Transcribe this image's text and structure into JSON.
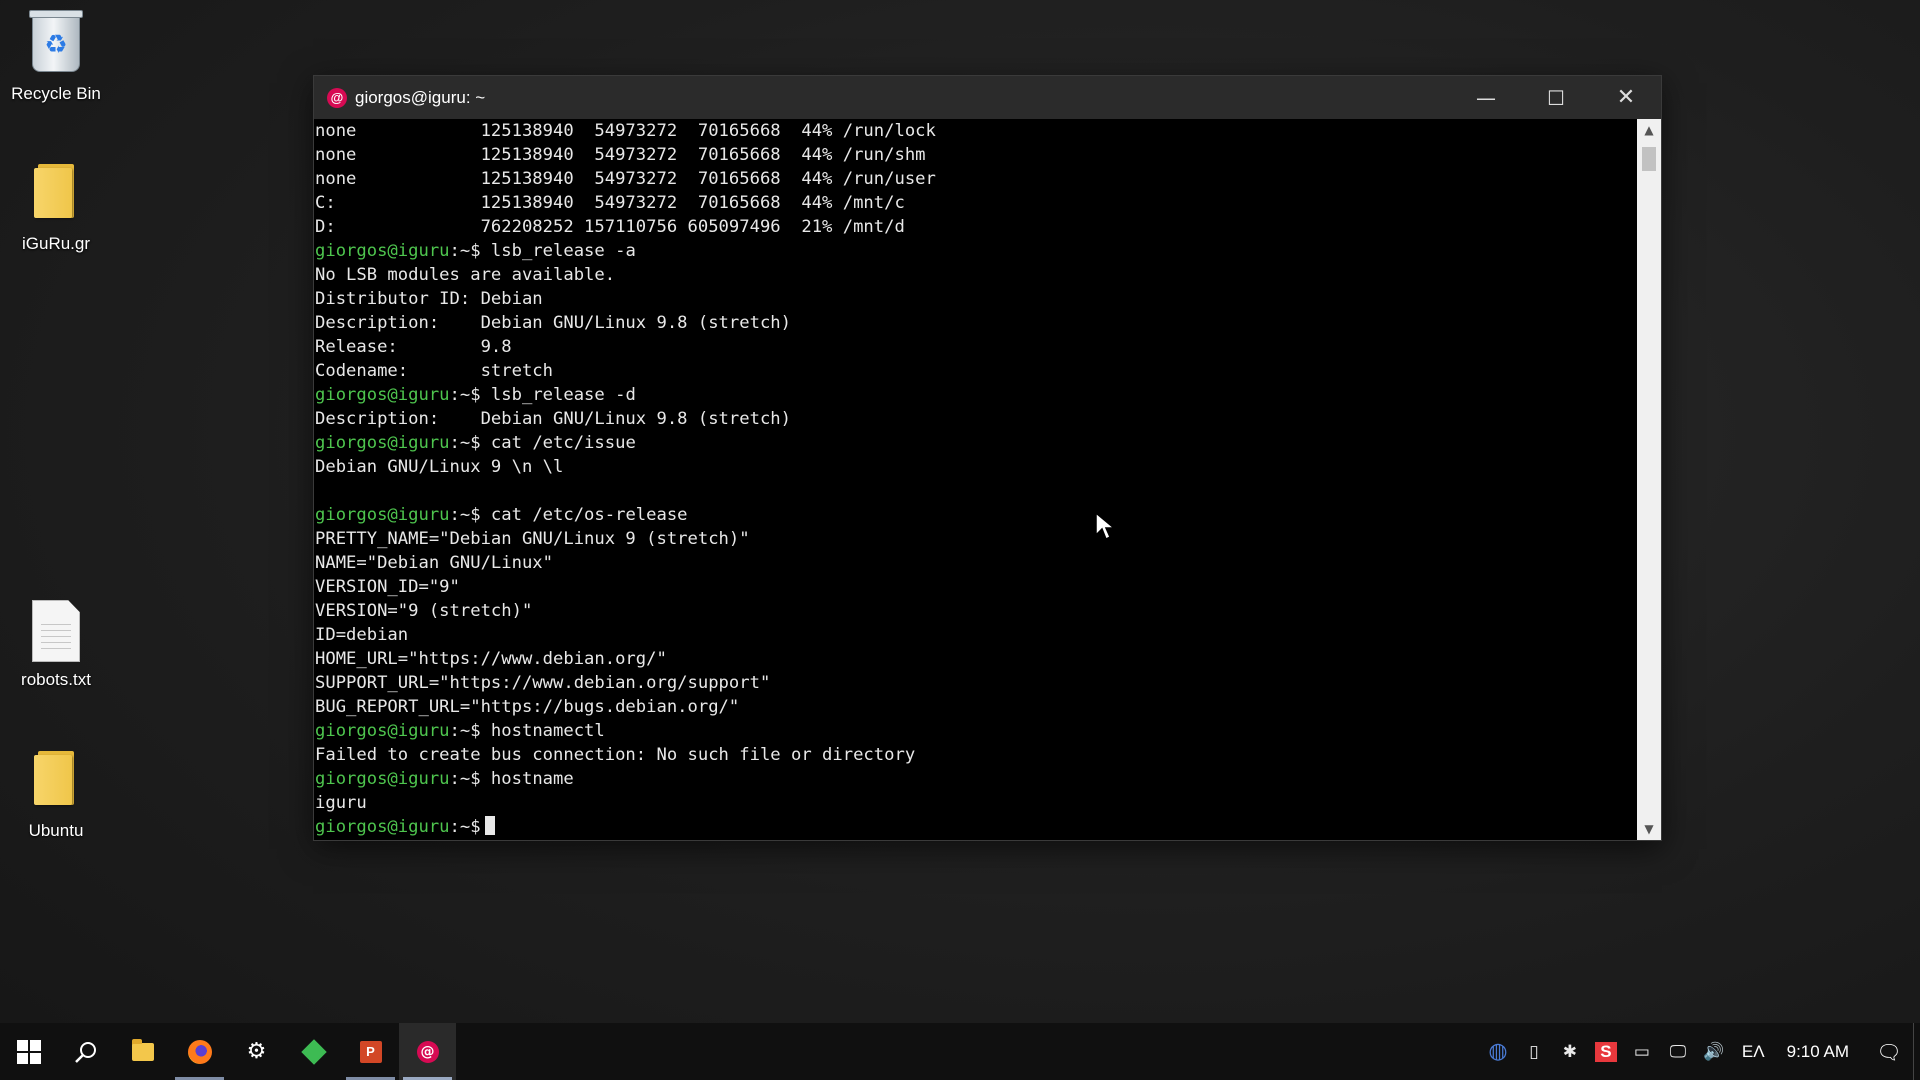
{
  "desktop": {
    "icons": [
      {
        "label": "Recycle Bin",
        "icon": "recycle-bin-icon"
      },
      {
        "label": "iGuRu.gr",
        "icon": "folder-icon"
      },
      {
        "label": "robots.txt",
        "icon": "text-file-icon"
      },
      {
        "label": "Ubuntu",
        "icon": "folder-icon"
      }
    ]
  },
  "window": {
    "title": "giorgos@iguru: ~",
    "app_icon": "debian-swirl-icon",
    "minimize_glyph": "—",
    "maximize_glyph": "☐",
    "close_glyph": "✕"
  },
  "terminal": {
    "prompt": "giorgos@iguru",
    "prompt_suffix": ":~$",
    "lines": [
      {
        "text": "none            125138940  54973272  70165668  44% /run/lock"
      },
      {
        "text": "none            125138940  54973272  70165668  44% /run/shm"
      },
      {
        "text": "none            125138940  54973272  70165668  44% /run/user"
      },
      {
        "text": "C:              125138940  54973272  70165668  44% /mnt/c"
      },
      {
        "text": "D:              762208252 157110756 605097496  21% /mnt/d"
      },
      {
        "prompt": true,
        "text": " lsb_release -a"
      },
      {
        "text": "No LSB modules are available."
      },
      {
        "text": "Distributor ID: Debian"
      },
      {
        "text": "Description:    Debian GNU/Linux 9.8 (stretch)"
      },
      {
        "text": "Release:        9.8"
      },
      {
        "text": "Codename:       stretch"
      },
      {
        "prompt": true,
        "text": " lsb_release -d"
      },
      {
        "text": "Description:    Debian GNU/Linux 9.8 (stretch)"
      },
      {
        "prompt": true,
        "text": " cat /etc/issue"
      },
      {
        "text": "Debian GNU/Linux 9 \\n \\l"
      },
      {
        "text": ""
      },
      {
        "prompt": true,
        "text": " cat /etc/os-release"
      },
      {
        "text": "PRETTY_NAME=\"Debian GNU/Linux 9 (stretch)\""
      },
      {
        "text": "NAME=\"Debian GNU/Linux\""
      },
      {
        "text": "VERSION_ID=\"9\""
      },
      {
        "text": "VERSION=\"9 (stretch)\""
      },
      {
        "text": "ID=debian"
      },
      {
        "text": "HOME_URL=\"https://www.debian.org/\""
      },
      {
        "text": "SUPPORT_URL=\"https://www.debian.org/support\""
      },
      {
        "text": "BUG_REPORT_URL=\"https://bugs.debian.org/\""
      },
      {
        "prompt": true,
        "text": " hostnamectl"
      },
      {
        "text": "Failed to create bus connection: No such file or directory"
      },
      {
        "prompt": true,
        "text": " hostname"
      },
      {
        "text": "iguru"
      },
      {
        "prompt": true,
        "text": "",
        "cursor": true
      }
    ]
  },
  "colors": {
    "prompt": "#4ec54e",
    "terminal_bg": "#000000",
    "terminal_fg": "#e8e8e8",
    "titlebar_bg": "#2b2b2b",
    "taskbar_bg": "#101010"
  },
  "taskbar": {
    "items": [
      {
        "name": "start-button",
        "icon": "windows-logo-icon"
      },
      {
        "name": "search-button",
        "icon": "search-icon",
        "glyph": "⚲"
      },
      {
        "name": "file-explorer-button",
        "icon": "folder-icon"
      },
      {
        "name": "firefox-button",
        "icon": "firefox-icon",
        "state": "running"
      },
      {
        "name": "settings-button",
        "icon": "gear-icon",
        "glyph": "⚙"
      },
      {
        "name": "green-app-button",
        "icon": "green-diamond-icon"
      },
      {
        "name": "powerpoint-button",
        "icon": "powerpoint-icon",
        "glyph": "P",
        "state": "running"
      },
      {
        "name": "debian-terminal-button",
        "icon": "debian-swirl-icon",
        "state": "active"
      }
    ],
    "tray_icons": [
      {
        "name": "tray-network-app-icon",
        "glyph": "◍"
      },
      {
        "name": "tray-usb-icon",
        "glyph": "▯"
      },
      {
        "name": "tray-slack-icon",
        "glyph": "✱"
      },
      {
        "name": "tray-s-app-icon",
        "glyph": "S"
      },
      {
        "name": "tray-battery-icon",
        "glyph": "▭"
      },
      {
        "name": "tray-network-icon",
        "glyph": "🖵"
      },
      {
        "name": "tray-volume-icon",
        "glyph": "🔊"
      }
    ],
    "language": "ΕΛ",
    "clock": "9:10 AM",
    "notification_glyph": "🗨"
  }
}
